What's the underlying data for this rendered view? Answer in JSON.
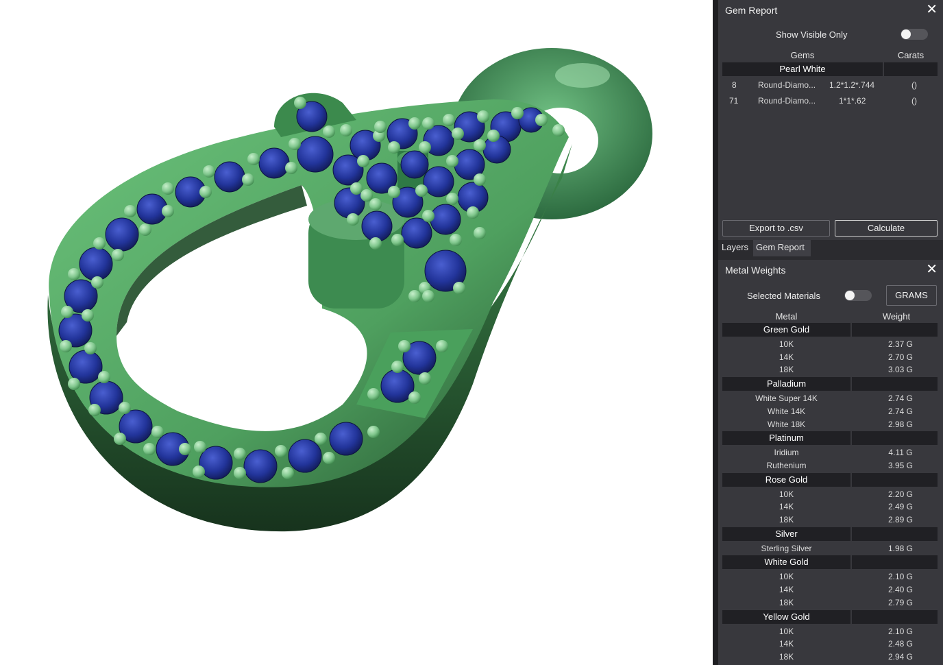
{
  "gem_report": {
    "title": "Gem Report",
    "close_glyph": "✕",
    "show_visible_only_label": "Show Visible Only",
    "show_visible_only_on": false,
    "columns": {
      "gems": "Gems",
      "carats": "Carats"
    },
    "group": "Pearl White",
    "rows": [
      {
        "count": "8",
        "name": "Round-Diamo...",
        "size": "1.2*1.2*.744",
        "carats": "()"
      },
      {
        "count": "71",
        "name": "Round-Diamo...",
        "size": "1*1*.62",
        "carats": "()"
      }
    ],
    "export_label": "Export to .csv",
    "calculate_label": "Calculate"
  },
  "tabs": [
    {
      "label": "Layers",
      "active": false
    },
    {
      "label": "Gem Report",
      "active": true
    }
  ],
  "metal_weights": {
    "title": "Metal Weights",
    "close_glyph": "✕",
    "selected_materials_label": "Selected Materials",
    "selected_materials_on": false,
    "units_label": "GRAMS",
    "columns": {
      "metal": "Metal",
      "weight": "Weight"
    },
    "groups": [
      {
        "name": "Green Gold",
        "rows": [
          {
            "metal": "10K",
            "weight": "2.37 G"
          },
          {
            "metal": "14K",
            "weight": "2.70 G"
          },
          {
            "metal": "18K",
            "weight": "3.03 G"
          }
        ]
      },
      {
        "name": "Palladium",
        "rows": [
          {
            "metal": "White Super 14K",
            "weight": "2.74 G"
          },
          {
            "metal": "White 14K",
            "weight": "2.74 G"
          },
          {
            "metal": "White 18K",
            "weight": "2.98 G"
          }
        ]
      },
      {
        "name": "Platinum",
        "rows": [
          {
            "metal": "Iridium",
            "weight": "4.11 G"
          },
          {
            "metal": "Ruthenium",
            "weight": "3.95 G"
          }
        ]
      },
      {
        "name": "Rose Gold",
        "rows": [
          {
            "metal": "10K",
            "weight": "2.20 G"
          },
          {
            "metal": "14K",
            "weight": "2.49 G"
          },
          {
            "metal": "18K",
            "weight": "2.89 G"
          }
        ]
      },
      {
        "name": "Silver",
        "rows": [
          {
            "metal": "Sterling Silver",
            "weight": "1.98 G"
          }
        ]
      },
      {
        "name": "White Gold",
        "rows": [
          {
            "metal": "10K",
            "weight": "2.10 G"
          },
          {
            "metal": "14K",
            "weight": "2.40 G"
          },
          {
            "metal": "18K",
            "weight": "2.79 G"
          }
        ]
      },
      {
        "name": "Yellow Gold",
        "rows": [
          {
            "metal": "10K",
            "weight": "2.10 G"
          },
          {
            "metal": "14K",
            "weight": "2.48 G"
          },
          {
            "metal": "18K",
            "weight": "2.94 G"
          }
        ]
      }
    ]
  },
  "viewport": {
    "model_metal_color": "#5bb26c",
    "model_shadow_color": "#2f6b3c",
    "gem_color": "#22349a",
    "prong_color": "#8fd09a"
  }
}
